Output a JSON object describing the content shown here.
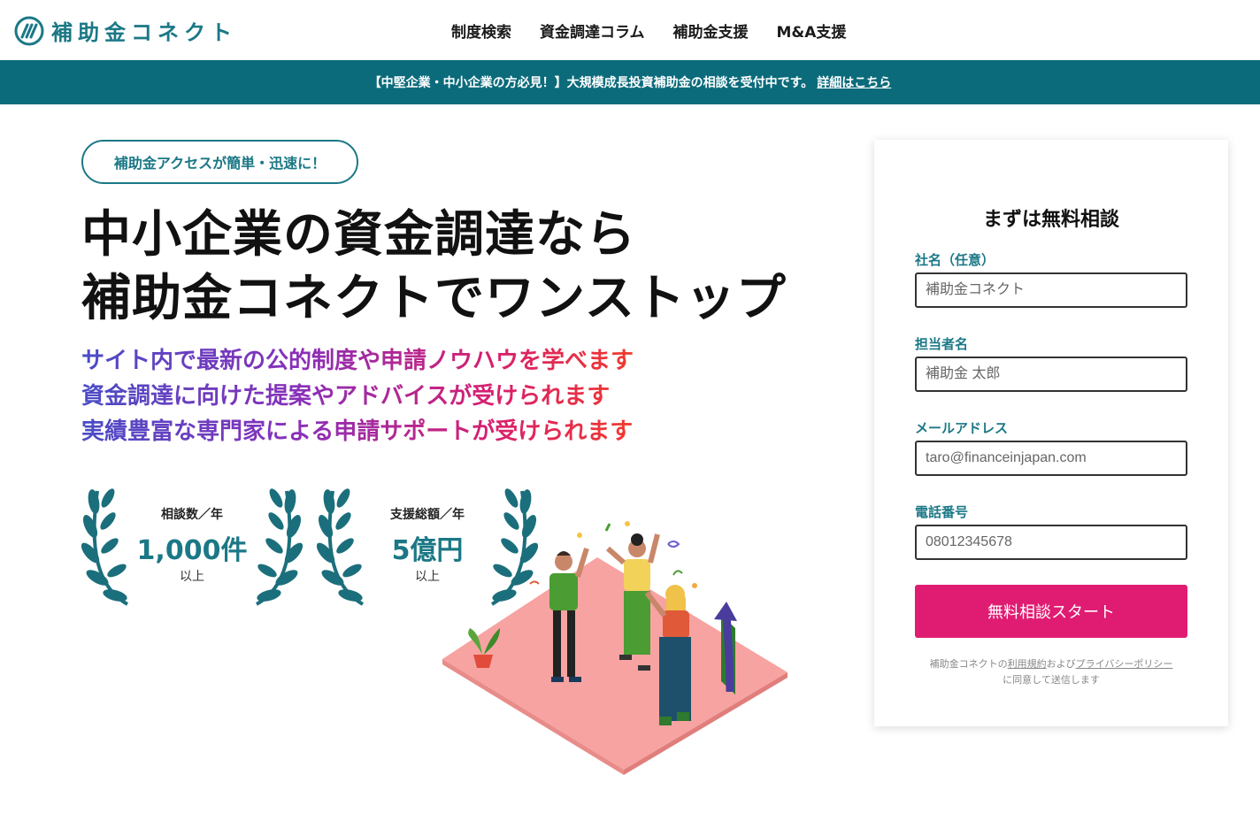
{
  "header": {
    "logo_text": "補助金コネクト",
    "nav": [
      "制度検索",
      "資金調達コラム",
      "補助金支援",
      "M&A支援"
    ]
  },
  "banner": {
    "text": "【中堅企業・中小企業の方必見！】大規模成長投資補助金の相談を受付中です。",
    "link": "詳細はこちら"
  },
  "hero": {
    "pill": "補助金アクセスが簡単・迅速に！",
    "headline_1": "中小企業の資金調達なら",
    "headline_2": "補助金コネクトでワンストップ",
    "sub": [
      "サイト内で最新の公的制度や申請ノウハウを学べます",
      "資金調達に向けた提案やアドバイスが受けられます",
      "実績豊富な専門家による申請サポートが受けられます"
    ],
    "stats": [
      {
        "label": "相談数／年",
        "value": "1,000件",
        "unit": "以上"
      },
      {
        "label": "支援総額／年",
        "value": "5億円",
        "unit": "以上"
      }
    ]
  },
  "form": {
    "title": "まずは無料相談",
    "fields": [
      {
        "label": "社名（任意）",
        "placeholder": "補助金コネクト"
      },
      {
        "label": "担当者名",
        "placeholder": "補助金 太郎"
      },
      {
        "label": "メールアドレス",
        "placeholder": "taro@financeinjapan.com"
      },
      {
        "label": "電話番号",
        "placeholder": "08012345678"
      }
    ],
    "submit": "無料相談スタート",
    "note_prefix": "補助金コネクトの",
    "note_terms": "利用規約",
    "note_mid": "および",
    "note_privacy": "プライバシーポリシー",
    "note_suffix": "に同意して送信します"
  },
  "colors": {
    "brand": "#1b7886",
    "banner": "#0b6b7b",
    "cta": "#e01c72"
  }
}
